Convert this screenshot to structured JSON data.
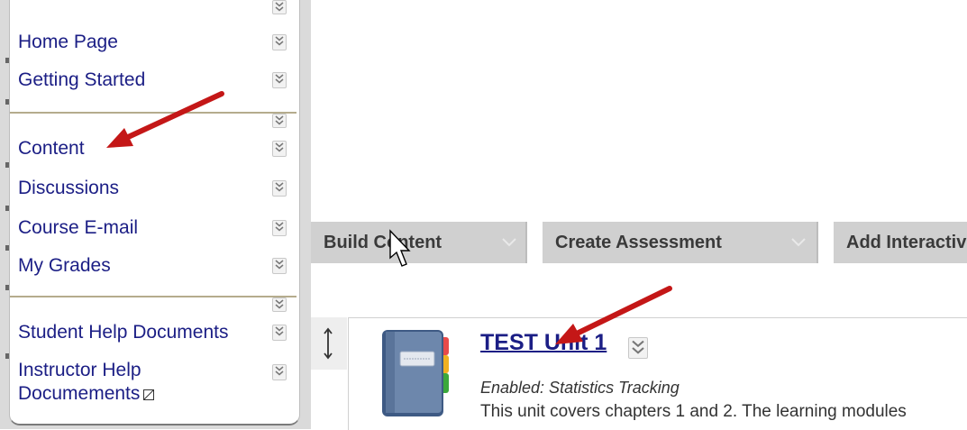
{
  "sidebar": {
    "items": [
      {
        "label": "Home Page"
      },
      {
        "label": "Getting Started"
      },
      {
        "label": "Content"
      },
      {
        "label": "Discussions"
      },
      {
        "label": "Course E-mail"
      },
      {
        "label": "My Grades"
      },
      {
        "label": "Student Help Documents"
      },
      {
        "label": "Instructor Help",
        "label2": "Documements"
      }
    ]
  },
  "toolbar": {
    "buttons": [
      {
        "label": "Build Content"
      },
      {
        "label": "Create Assessment"
      },
      {
        "label": "Add Interactive Tool"
      }
    ]
  },
  "content_item": {
    "title": "TEST Unit 1",
    "status": "Enabled: Statistics Tracking",
    "description": "This unit covers chapters 1 and 2.  The learning modules"
  },
  "icons": {
    "section_options": "double-chevron-down-icon",
    "item_options": "double-chevron-down-icon",
    "drag_handle": "vertical-arrows-icon",
    "item_type": "notebook-icon",
    "cursor": "mouse-pointer-icon"
  },
  "colors": {
    "link": "#1b1e85",
    "annotation_arrow": "#c41717",
    "toolbar_bg": "#d0d0d0",
    "divider": "#b5ac8d"
  }
}
